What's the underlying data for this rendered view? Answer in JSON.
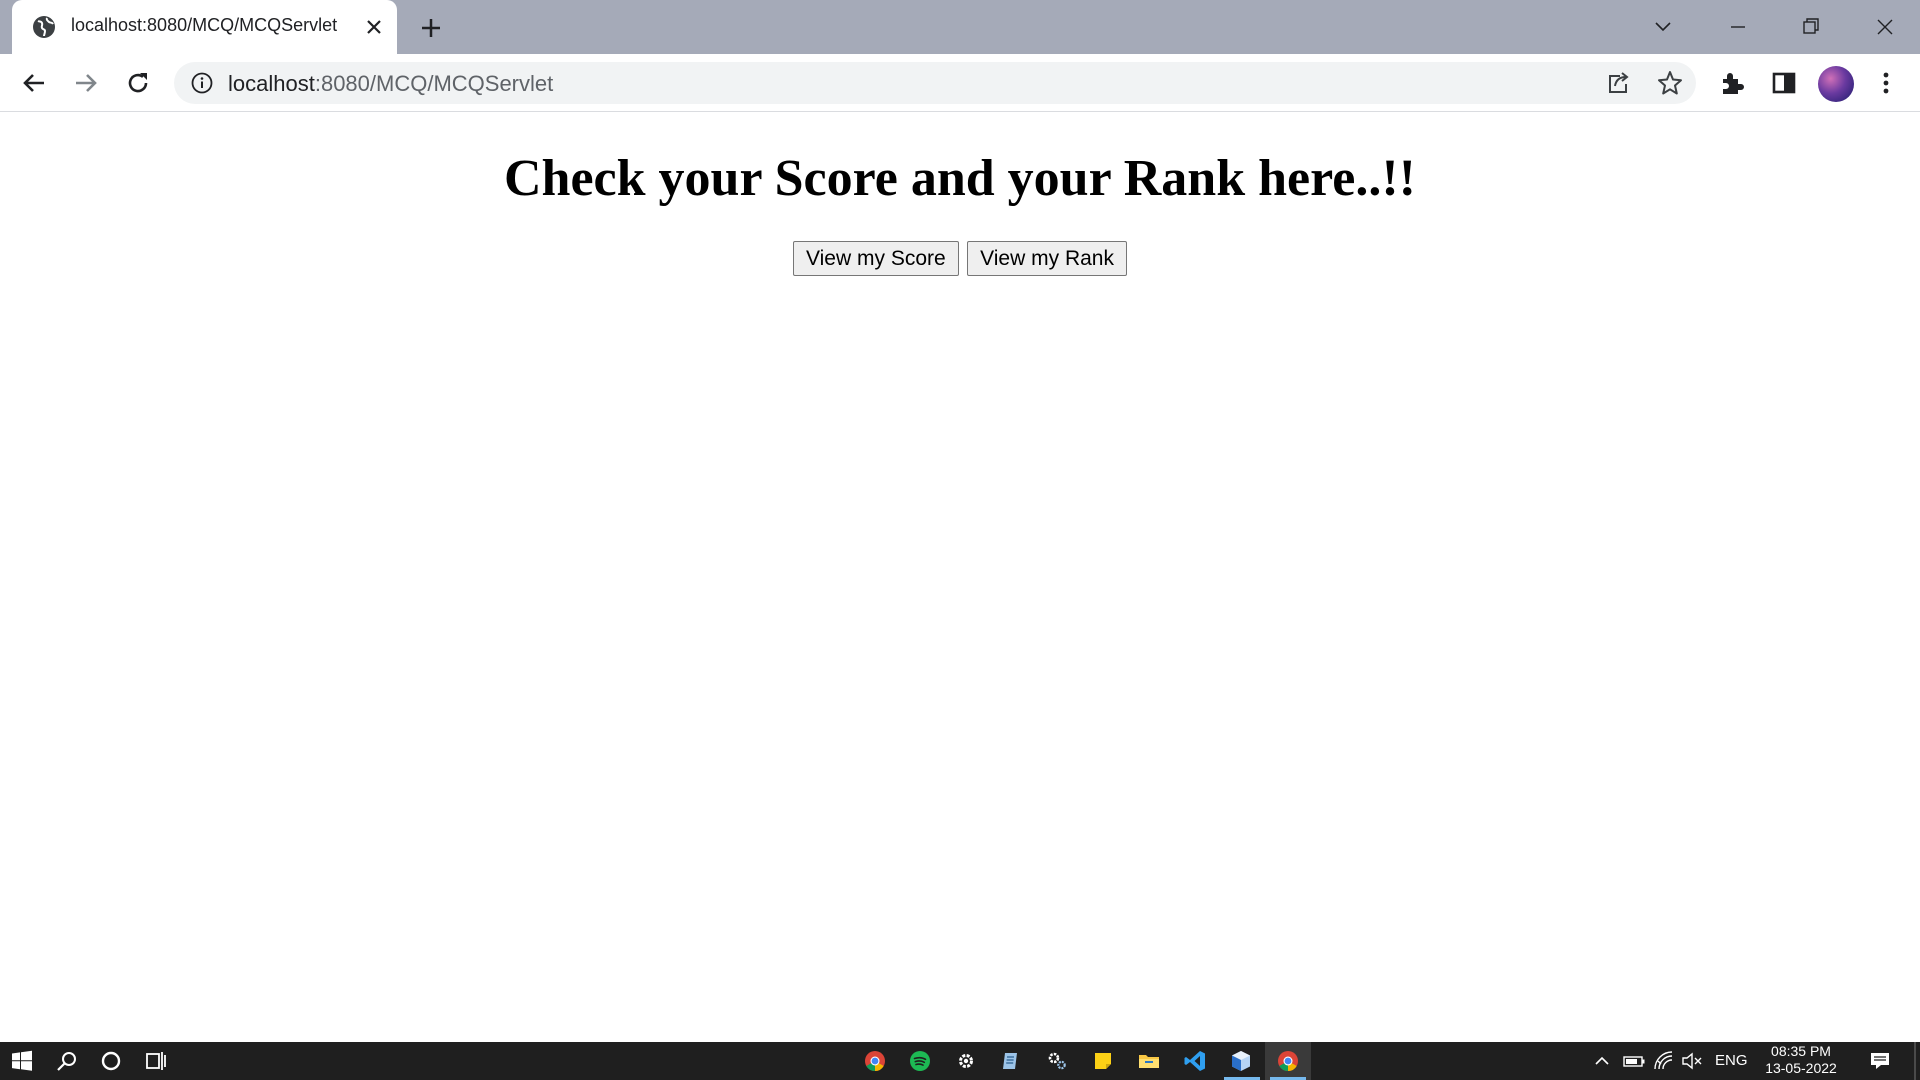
{
  "browser": {
    "tab": {
      "title": "localhost:8080/MCQ/MCQServlet",
      "favicon": "globe-icon"
    },
    "url": {
      "host": "localhost",
      "rest": ":8080/MCQ/MCQServlet"
    },
    "toolbar_icons": [
      "back-icon",
      "forward-icon",
      "reload-icon",
      "site-info-icon",
      "share-icon",
      "bookmark-star-icon",
      "extensions-icon",
      "side-panel-icon",
      "profile-avatar",
      "menu-dots-icon"
    ],
    "window_controls": [
      "tab-search-icon",
      "minimize-icon",
      "restore-icon",
      "close-window-icon"
    ]
  },
  "page": {
    "heading": "Check your Score and your Rank here..!!",
    "buttons": {
      "score": "View my Score",
      "rank": "View my Rank"
    }
  },
  "taskbar": {
    "pinned": [
      "chrome",
      "spotify",
      "settings",
      "notepad",
      "control-panel",
      "sticky-notes",
      "file-explorer",
      "vscode",
      "virtualbox",
      "chrome-active"
    ],
    "tray": {
      "language": "ENG",
      "time": "08:35 PM",
      "date": "13-05-2022"
    }
  },
  "colors": {
    "tabstrip": "#a5aab8",
    "taskbar": "#1f1f1f",
    "accent": "#76b9ed"
  }
}
